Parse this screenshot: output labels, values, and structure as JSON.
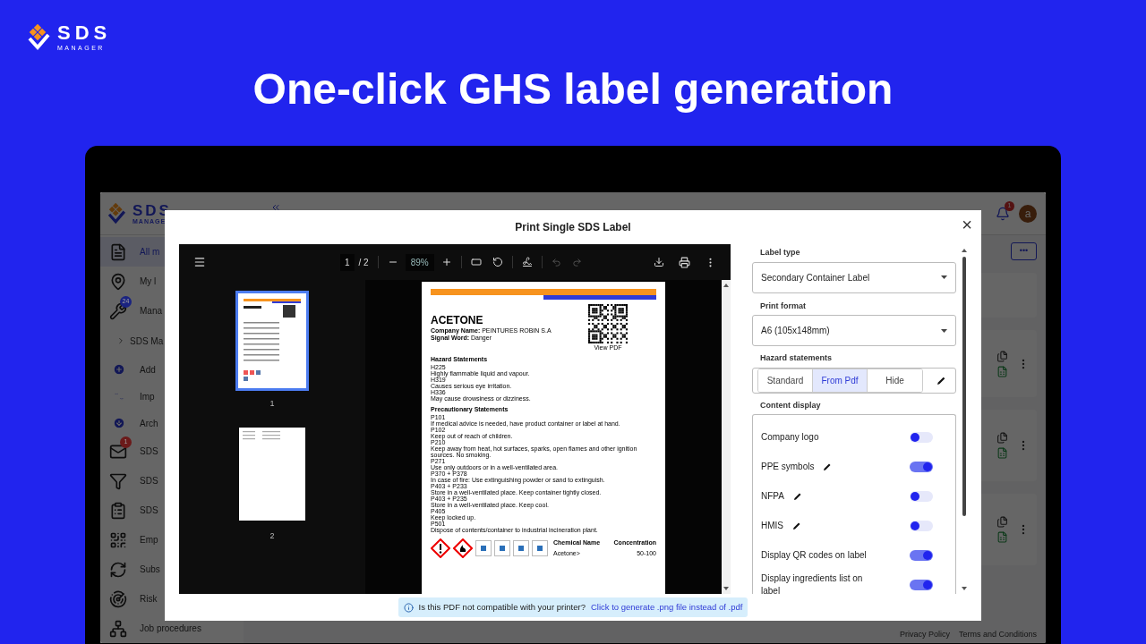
{
  "brand": {
    "name": "SDS",
    "sub": "MANAGER"
  },
  "headline": "One-click GHS label generation",
  "app": {
    "logo": {
      "name": "SDS",
      "sub": "MANAGE"
    },
    "sidebar": [
      {
        "label": "All m",
        "kind": "main",
        "selected": true
      },
      {
        "label": "My l",
        "kind": "main",
        "selected": false
      },
      {
        "label": "Mana",
        "kind": "main",
        "selected": false,
        "badge": "24",
        "color": "#1a2380"
      },
      {
        "label": "SDS Ma",
        "kind": "group",
        "selected": false
      },
      {
        "label": "Add",
        "kind": "sub",
        "selected": false
      },
      {
        "label": "Imp",
        "kind": "sub",
        "selected": false
      },
      {
        "label": "Arch",
        "kind": "sub",
        "selected": false
      },
      {
        "label": "SDS",
        "kind": "main",
        "selected": false,
        "badge": "1",
        "color": "#6b1a1a"
      },
      {
        "label": "SDS",
        "kind": "main",
        "selected": false
      },
      {
        "label": "SDS",
        "kind": "main",
        "selected": false
      },
      {
        "label": "Emp",
        "kind": "main",
        "selected": false
      },
      {
        "label": "Subs",
        "kind": "main",
        "selected": false
      },
      {
        "label": "Risk",
        "kind": "main",
        "selected": false
      },
      {
        "label": "Job procedures",
        "kind": "main",
        "selected": false
      }
    ],
    "notification_count": "1",
    "avatar": "a",
    "more_button": "•••",
    "footer_links": [
      "Privacy Policy",
      "Terms and Conditions"
    ]
  },
  "dialog": {
    "title": "Print Single SDS Label",
    "close": "×",
    "viewer": {
      "page_input": "1",
      "page_total": "/ 2",
      "zoom": "89%",
      "thumbnails": [
        {
          "label": "1",
          "selected": true
        },
        {
          "label": "2",
          "selected": false
        }
      ],
      "page": {
        "title": "ACETONE",
        "company_label": "Company Name:",
        "company": "PEINTURES ROBIN S.A",
        "signal_label": "Signal Word:",
        "signal": "Danger",
        "qr_caption": "View PDF",
        "sections": [
          {
            "heading": "Hazard Statements",
            "lines": [
              "H225",
              "Highly flammable liquid and vapour.",
              "H319",
              "Causes serious eye irritation.",
              "H336",
              "May cause drowsiness or dizziness."
            ]
          },
          {
            "heading": "Precautionary Statements",
            "lines": [
              "P101",
              "If medical advice is needed, have product container or label at hand.",
              "P102",
              "Keep out of reach of children.",
              "P210",
              "Keep away from heat, hot surfaces, sparks, open flames and other ignition sources. No smoking.",
              "P271",
              "Use only outdoors or in a well-ventilated area.",
              "P370 + P378",
              "In case of fire: Use extinguishing powder or sand to extinguish.",
              "P403 + P233",
              "Store in a well-ventilated place. Keep container tightly closed.",
              "P403 + P235",
              "Store in a well-ventilated place. Keep cool.",
              "P405",
              "Keep locked up.",
              "P501",
              "Dispose of contents/container to industrial incineration plant."
            ]
          }
        ],
        "pictograms": [
          {
            "kind": "exclamation"
          },
          {
            "kind": "flame"
          },
          {
            "kind": "ppe"
          },
          {
            "kind": "ppe"
          },
          {
            "kind": "ppe"
          },
          {
            "kind": "ppe"
          }
        ],
        "table": {
          "columns": [
            "Chemical Name",
            "Concentration"
          ],
          "rows": [
            [
              "Acetone>",
              "50-100"
            ]
          ]
        }
      }
    },
    "settings": {
      "label_type": {
        "legend": "Label type",
        "value": "Secondary Container Label"
      },
      "print_format": {
        "legend": "Print format",
        "value": "A6 (105x148mm)"
      },
      "hazard_statements": {
        "legend": "Hazard statements",
        "options": [
          {
            "label": "Standard",
            "selected": false
          },
          {
            "label": "From Pdf",
            "selected": true
          },
          {
            "label": "Hide",
            "selected": false
          }
        ]
      },
      "content_display": {
        "legend": "Content display",
        "items": [
          {
            "label": "Company logo",
            "editable": false,
            "on": false
          },
          {
            "label": "PPE symbols",
            "editable": true,
            "on": true
          },
          {
            "label": "NFPA",
            "editable": true,
            "on": false
          },
          {
            "label": "HMIS",
            "editable": true,
            "on": false
          },
          {
            "label": "Display QR codes on label",
            "editable": false,
            "on": true
          },
          {
            "label": "Display ingredients list on label",
            "editable": false,
            "on": true
          }
        ]
      }
    },
    "notice": {
      "text": "Is this PDF not compatible with your printer?",
      "link": "Click to generate .png file instead of .pdf"
    }
  }
}
